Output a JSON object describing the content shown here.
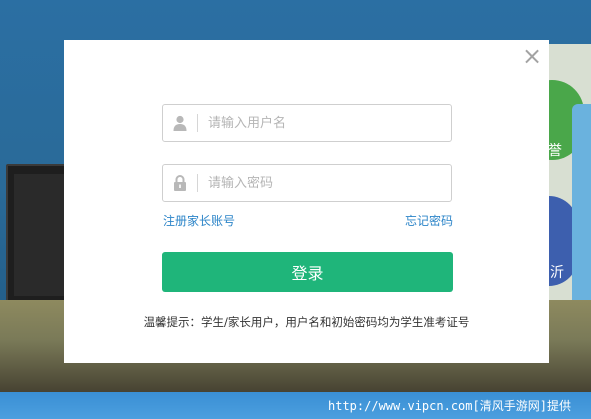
{
  "background": {
    "circle1_text": "誉",
    "circle2_text": "沂",
    "watermark": "http://www.vipcn.com[清风手游网]提供"
  },
  "login": {
    "username_placeholder": "请输入用户名",
    "password_placeholder": "请输入密码",
    "register_link": "注册家长账号",
    "forgot_link": "忘记密码",
    "login_button": "登录",
    "tip": "温馨提示：学生/家长用户，用户名和初始密码均为学生准考证号",
    "close_symbol": "×"
  },
  "colors": {
    "accent_green": "#1fb57a",
    "link_blue": "#2b84c8"
  }
}
